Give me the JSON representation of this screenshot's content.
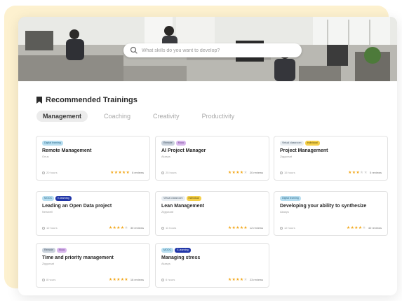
{
  "search": {
    "placeholder": "What skills do you want to develop?"
  },
  "section": {
    "title": "Recommended Trainings"
  },
  "tabs": [
    {
      "label": "Management",
      "active": true
    },
    {
      "label": "Coaching",
      "active": false
    },
    {
      "label": "Creativity",
      "active": false
    },
    {
      "label": "Productivity",
      "active": false
    }
  ],
  "colors": {
    "star": "#f2a81c",
    "backdrop": "#fdf1cf",
    "badge_navy": "#2136a8"
  },
  "trainings": [
    {
      "badges": [
        {
          "text": "Digital learning",
          "kind": "blue"
        }
      ],
      "name": "Remote Management",
      "provider": "Onus",
      "duration": "20 hours",
      "rating": 5,
      "reviews": "8 reviews"
    },
    {
      "badges": [
        {
          "text": "Remote",
          "kind": "grey"
        },
        {
          "text": "Mooc",
          "kind": "purple"
        }
      ],
      "name": "AI Project Manager",
      "provider": "Akasys",
      "duration": "25 hours",
      "rating": 4,
      "reviews": "20 reviews"
    },
    {
      "badges": [
        {
          "text": "Virtual classroom",
          "kind": "plain"
        },
        {
          "text": "Individual",
          "kind": "yellow"
        }
      ],
      "name": "Project Management",
      "provider": "Zigguraat",
      "duration": "15 hours",
      "rating": 3,
      "reviews": "5 reviews"
    },
    {
      "badges": [
        {
          "text": "MOOC",
          "kind": "blue"
        },
        {
          "text": "E-learning",
          "kind": "navy"
        }
      ],
      "name": "Leading an Open Data project",
      "provider": "Newwell",
      "duration": "12 hours",
      "rating": 4,
      "reviews": "30 reviews"
    },
    {
      "badges": [
        {
          "text": "Virtual classroom",
          "kind": "plain"
        },
        {
          "text": "Individual",
          "kind": "yellow"
        }
      ],
      "name": "Lean Management",
      "provider": "Zigguraat",
      "duration": "11 hours",
      "rating": 5,
      "reviews": "12 reviews"
    },
    {
      "badges": [
        {
          "text": "Digital learning",
          "kind": "blue"
        }
      ],
      "name": "Developing your ability to synthesize",
      "provider": "Akasys",
      "duration": "12 hours",
      "rating": 4,
      "reviews": "40 reviews"
    },
    {
      "badges": [
        {
          "text": "Remote",
          "kind": "grey"
        },
        {
          "text": "Mooc",
          "kind": "purple"
        }
      ],
      "name": "Time and priority management",
      "provider": "Zigguraat",
      "duration": "8 hours",
      "rating": 5,
      "reviews": "18 reviews"
    },
    {
      "badges": [
        {
          "text": "MOOC",
          "kind": "blue"
        },
        {
          "text": "E-learning",
          "kind": "navy"
        }
      ],
      "name": "Managing stress",
      "provider": "Akasys",
      "duration": "6 hours",
      "rating": 4,
      "reviews": "23 reviews"
    }
  ]
}
